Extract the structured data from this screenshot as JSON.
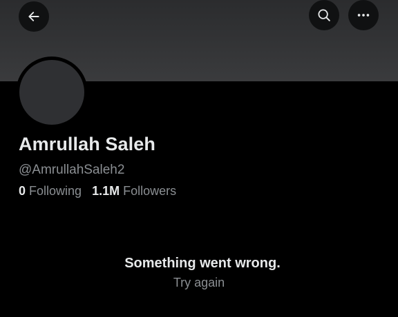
{
  "icons": {
    "back": "arrow-left-icon",
    "search": "search-icon",
    "more": "more-horizontal-icon"
  },
  "colors": {
    "background": "#000000",
    "banner": "#333436",
    "avatar": "#2f3033",
    "primary_text": "#e7e9ea",
    "secondary_text": "#8b8f93"
  },
  "profile": {
    "display_name": "Amrullah Saleh",
    "handle": "@AmrullahSaleh2",
    "following_count": "0",
    "following_label": "Following",
    "followers_count": "1.1M",
    "followers_label": "Followers"
  },
  "error": {
    "message": "Something went wrong.",
    "retry_label": "Try again"
  }
}
